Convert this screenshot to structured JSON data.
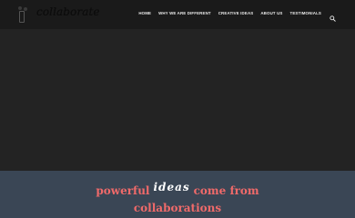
{
  "brand": {
    "name": "collaborate"
  },
  "nav": {
    "items": [
      {
        "label": "HOME"
      },
      {
        "label": "WHY WE ARE DIFFERENT"
      },
      {
        "label": "CREATIVE IDEAS"
      },
      {
        "label": "ABOUT US"
      },
      {
        "label": "TESTIMONIALS"
      }
    ],
    "search_icon": "search-icon"
  },
  "banner": {
    "line1_a": "powerful",
    "line1_script": "ideas",
    "line1_b": "come from",
    "line2": "collaborations"
  },
  "colors": {
    "nav_bg": "#1a1a1a",
    "hero_bg": "#232323",
    "band_bg": "#3a4655",
    "accent": "#f06a6a"
  }
}
